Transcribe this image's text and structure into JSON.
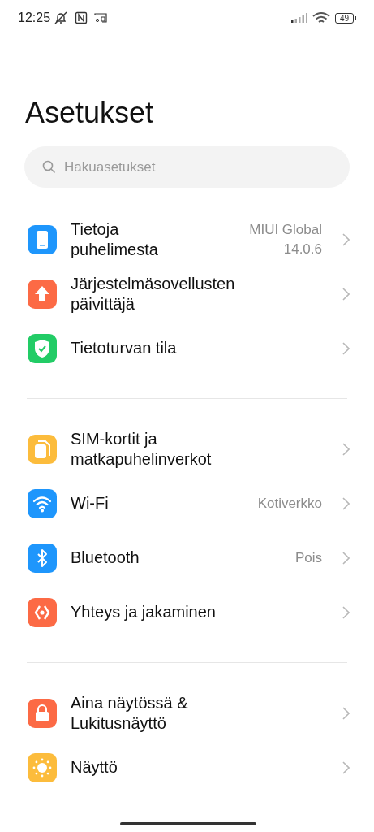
{
  "status_bar": {
    "time": "12:25",
    "battery": "49"
  },
  "title": "Asetukset",
  "search": {
    "placeholder": "Hakuasetukset"
  },
  "sections": [
    {
      "items": [
        {
          "kind": "phone",
          "color": "#1e96fc",
          "label": "Tietoja puhelimesta",
          "value": "MIUI Global 14.0.6"
        },
        {
          "kind": "update",
          "color": "#fc6a45",
          "label": "Järjestelmäsovellusten päivittäjä"
        },
        {
          "kind": "shield",
          "color": "#22cc66",
          "label": "Tietoturvan tila"
        }
      ]
    },
    {
      "items": [
        {
          "kind": "sim",
          "color": "#fcbc3c",
          "label": "SIM-kortit ja matkapuhelinverkot"
        },
        {
          "kind": "wifi",
          "color": "#1e96fc",
          "label": "Wi-Fi",
          "value": "Kotiverkko"
        },
        {
          "kind": "bluetooth",
          "color": "#1e96fc",
          "label": "Bluetooth",
          "value": "Pois"
        },
        {
          "kind": "share",
          "color": "#fc6a45",
          "label": "Yhteys ja jakaminen"
        }
      ]
    },
    {
      "items": [
        {
          "kind": "lock",
          "color": "#fc6a45",
          "label": "Aina näytössä & Lukitusnäyttö"
        },
        {
          "kind": "sun",
          "color": "#fcbc3c",
          "label": "Näyttö"
        }
      ]
    }
  ]
}
